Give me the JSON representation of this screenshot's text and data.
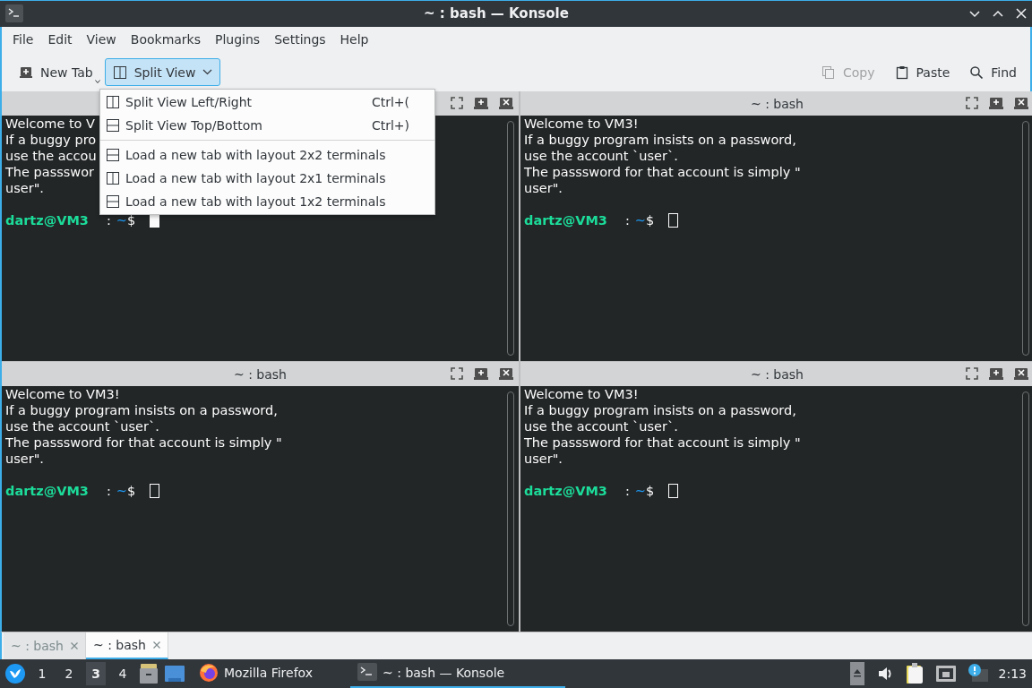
{
  "window": {
    "title": "~ : bash — Konsole"
  },
  "menubar": [
    "File",
    "Edit",
    "View",
    "Bookmarks",
    "Plugins",
    "Settings",
    "Help"
  ],
  "toolbar": {
    "left": [
      {
        "label": "New Tab",
        "kind": "new-tab",
        "pressed": false,
        "disabled": false
      },
      {
        "label": "Split View",
        "kind": "split",
        "pressed": true,
        "disabled": false
      }
    ],
    "right": [
      {
        "label": "Copy",
        "kind": "copy",
        "pressed": false,
        "disabled": true
      },
      {
        "label": "Paste",
        "kind": "paste",
        "pressed": false,
        "disabled": false
      },
      {
        "label": "Find",
        "kind": "find",
        "pressed": false,
        "disabled": false
      }
    ]
  },
  "split_menu": {
    "sections": [
      [
        {
          "label": "Split View Left/Right",
          "shortcut": "Ctrl+(",
          "kind": "columns"
        },
        {
          "label": "Split View Top/Bottom",
          "shortcut": "Ctrl+)",
          "kind": "rows"
        }
      ],
      [
        {
          "label": "Load a new tab with layout 2x2 terminals",
          "kind": "rows"
        },
        {
          "label": "Load a new tab with layout 2x1 terminals",
          "kind": "columns"
        },
        {
          "label": "Load a new tab with layout 1x2 terminals",
          "kind": "rows"
        }
      ]
    ]
  },
  "panes": [
    {
      "lines": [
        "Welcome to V",
        "If a buggy pro",
        "use the accou",
        "The passswor",
        "user\"."
      ],
      "prompt": {
        "user": "dartz@VM3",
        "separator": ":",
        "path": "~",
        "symbol": "$"
      },
      "focused": true,
      "maximized": false
    },
    {
      "title": "~ : bash",
      "lines": [
        "Welcome to VM3!",
        "If a buggy program insists on a password,",
        "use the account `user`.",
        "The passsword for that account is simply \"",
        "user\"."
      ],
      "prompt": {
        "user": "dartz@VM3",
        "separator": ":",
        "path": "~",
        "symbol": "$"
      },
      "focused": false,
      "maximized": false
    },
    {
      "title": "~ : bash",
      "lines": [
        "Welcome to VM3!",
        "If a buggy program insists on a password,",
        "use the account `user`.",
        "The passsword for that account is simply \"",
        "user\"."
      ],
      "prompt": {
        "user": "dartz@VM3",
        "separator": ":",
        "path": "~",
        "symbol": "$"
      },
      "focused": false,
      "maximized": false
    },
    {
      "title": "~ : bash",
      "lines": [
        "Welcome to VM3!",
        "If a buggy program insists on a password,",
        "use the account `user`.",
        "The passsword for that account is simply \"",
        "user\"."
      ],
      "prompt": {
        "user": "dartz@VM3",
        "separator": ":",
        "path": "~",
        "symbol": "$"
      },
      "focused": false,
      "maximized": false
    }
  ],
  "tabs": [
    {
      "label": "~ : bash",
      "selected": false
    },
    {
      "label": "~ : bash",
      "selected": true
    }
  ],
  "taskbar": {
    "desktops": [
      {
        "label": "1",
        "selected": false
      },
      {
        "label": "2",
        "selected": false
      },
      {
        "label": "3",
        "selected": true
      },
      {
        "label": "4",
        "selected": false
      }
    ],
    "tasks": [
      {
        "label": "Mozilla Firefox",
        "kind": "firefox",
        "active": false
      },
      {
        "label": "~ : bash — Konsole",
        "kind": "konsole",
        "active": true
      }
    ],
    "clock": "2:13"
  }
}
